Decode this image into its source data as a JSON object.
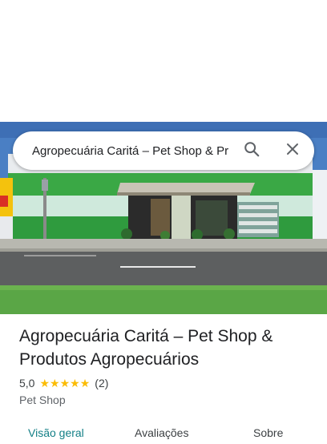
{
  "search": {
    "query": "Agropecuária Caritá – Pet Shop & Pr"
  },
  "place": {
    "title": "Agropecuária Caritá – Pet Shop & Produtos Agropecuários",
    "rating": "5,0",
    "stars": 5,
    "review_count": "(2)",
    "category": "Pet Shop"
  },
  "tabs": [
    {
      "label": "Visão geral",
      "active": true
    },
    {
      "label": "Avaliações",
      "active": false
    },
    {
      "label": "Sobre",
      "active": false
    }
  ],
  "icons": {
    "search": "search-icon",
    "close": "close-icon",
    "star": "star-icon"
  },
  "colors": {
    "accent": "#137f86",
    "star": "#fbbc04",
    "storefront_green": "#3aa845"
  }
}
